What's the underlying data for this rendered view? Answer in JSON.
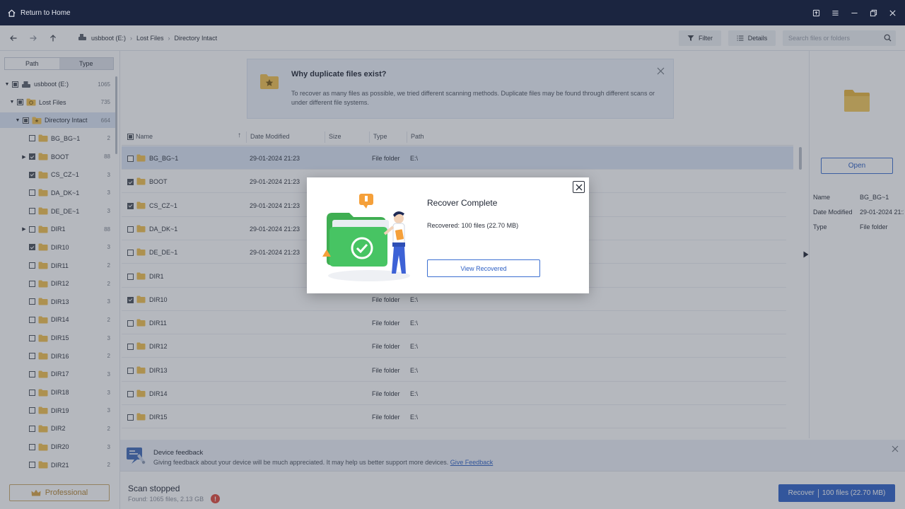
{
  "titlebar": {
    "home_label": "Return to Home"
  },
  "toolbar": {
    "breadcrumb": [
      "usbboot (E:)",
      "Lost Files",
      "Directory Intact"
    ],
    "filter_label": "Filter",
    "details_label": "Details",
    "search_placeholder": "Search files or folders"
  },
  "sidebar": {
    "tabs": [
      "Path",
      "Type"
    ],
    "tree": [
      {
        "label": "usbboot (E:)",
        "count": "1065",
        "level": 0,
        "expanded": true,
        "check": "partial",
        "icon": "drive-icon"
      },
      {
        "label": "Lost Files",
        "count": "735",
        "level": 1,
        "expanded": true,
        "check": "partial",
        "icon": "lost-files-icon"
      },
      {
        "label": "Directory Intact",
        "count": "664",
        "level": 2,
        "expanded": true,
        "check": "partial",
        "icon": "star-folder-icon",
        "selected": true
      },
      {
        "label": "BG_BG~1",
        "count": "2",
        "level": 3,
        "check": "none"
      },
      {
        "label": "BOOT",
        "count": "88",
        "level": 3,
        "expandable": true,
        "check": "checked"
      },
      {
        "label": "CS_CZ~1",
        "count": "3",
        "level": 3,
        "check": "checked"
      },
      {
        "label": "DA_DK~1",
        "count": "3",
        "level": 3,
        "check": "none"
      },
      {
        "label": "DE_DE~1",
        "count": "3",
        "level": 3,
        "check": "none"
      },
      {
        "label": "DIR1",
        "count": "88",
        "level": 3,
        "expandable": true,
        "check": "none"
      },
      {
        "label": "DIR10",
        "count": "3",
        "level": 3,
        "check": "checked"
      },
      {
        "label": "DIR11",
        "count": "2",
        "level": 3,
        "check": "none"
      },
      {
        "label": "DIR12",
        "count": "2",
        "level": 3,
        "check": "none"
      },
      {
        "label": "DIR13",
        "count": "3",
        "level": 3,
        "check": "none"
      },
      {
        "label": "DIR14",
        "count": "2",
        "level": 3,
        "check": "none"
      },
      {
        "label": "DIR15",
        "count": "3",
        "level": 3,
        "check": "none"
      },
      {
        "label": "DIR16",
        "count": "2",
        "level": 3,
        "check": "none"
      },
      {
        "label": "DIR17",
        "count": "3",
        "level": 3,
        "check": "none"
      },
      {
        "label": "DIR18",
        "count": "3",
        "level": 3,
        "check": "none"
      },
      {
        "label": "DIR19",
        "count": "3",
        "level": 3,
        "check": "none"
      },
      {
        "label": "DIR2",
        "count": "2",
        "level": 3,
        "check": "none"
      },
      {
        "label": "DIR20",
        "count": "3",
        "level": 3,
        "check": "none"
      },
      {
        "label": "DIR21",
        "count": "2",
        "level": 3,
        "check": "none"
      }
    ],
    "pro_label": "Professional"
  },
  "banner": {
    "title": "Why duplicate files exist?",
    "text": "To recover as many files as possible, we tried different scanning methods. Duplicate files may be found through different scans or under different file systems."
  },
  "table": {
    "columns": [
      "Name",
      "Date Modified",
      "Size",
      "Type",
      "Path"
    ],
    "rows": [
      {
        "name": "BG_BG~1",
        "date": "29-01-2024 21:23",
        "type": "File folder",
        "path": "E:\\",
        "checked": false,
        "selected": true
      },
      {
        "name": "BOOT",
        "date": "29-01-2024 21:23",
        "type": "",
        "path": "",
        "checked": true
      },
      {
        "name": "CS_CZ~1",
        "date": "29-01-2024 21:23",
        "type": "",
        "path": "",
        "checked": true
      },
      {
        "name": "DA_DK~1",
        "date": "29-01-2024 21:23",
        "type": "",
        "path": "",
        "checked": false
      },
      {
        "name": "DE_DE~1",
        "date": "29-01-2024 21:23",
        "type": "",
        "path": "",
        "checked": false
      },
      {
        "name": "DIR1",
        "date": "",
        "type": "",
        "path": "",
        "checked": false
      },
      {
        "name": "DIR10",
        "date": "",
        "type": "File folder",
        "path": "E:\\",
        "checked": true
      },
      {
        "name": "DIR11",
        "date": "",
        "type": "File folder",
        "path": "E:\\",
        "checked": false
      },
      {
        "name": "DIR12",
        "date": "",
        "type": "File folder",
        "path": "E:\\",
        "checked": false
      },
      {
        "name": "DIR13",
        "date": "",
        "type": "File folder",
        "path": "E:\\",
        "checked": false
      },
      {
        "name": "DIR14",
        "date": "",
        "type": "File folder",
        "path": "E:\\",
        "checked": false
      },
      {
        "name": "DIR15",
        "date": "",
        "type": "File folder",
        "path": "E:\\",
        "checked": false
      }
    ]
  },
  "details": {
    "open_label": "Open",
    "fields": [
      {
        "key": "Name",
        "value": "BG_BG~1"
      },
      {
        "key": "Date Modified",
        "value": "29-01-2024 21:23"
      },
      {
        "key": "Type",
        "value": "File folder"
      }
    ]
  },
  "feedback": {
    "title": "Device feedback",
    "text": "Giving feedback about your device will be much appreciated. It may help us better support more devices. ",
    "link": "Give Feedback"
  },
  "status": {
    "title": "Scan stopped",
    "found": "Found: 1065 files, 2.13 GB",
    "warn": "!"
  },
  "recover_button": {
    "label": "Recover",
    "detail": "100 files (22.70 MB)"
  },
  "modal": {
    "title": "Recover Complete",
    "text": "Recovered: 100 files (22.70 MB)",
    "button": "View Recovered"
  },
  "colors": {
    "titlebar": "#1b2540",
    "accent": "#2e62c8",
    "folder": "#f2c14e",
    "selected_row": "#dbe6f6"
  }
}
